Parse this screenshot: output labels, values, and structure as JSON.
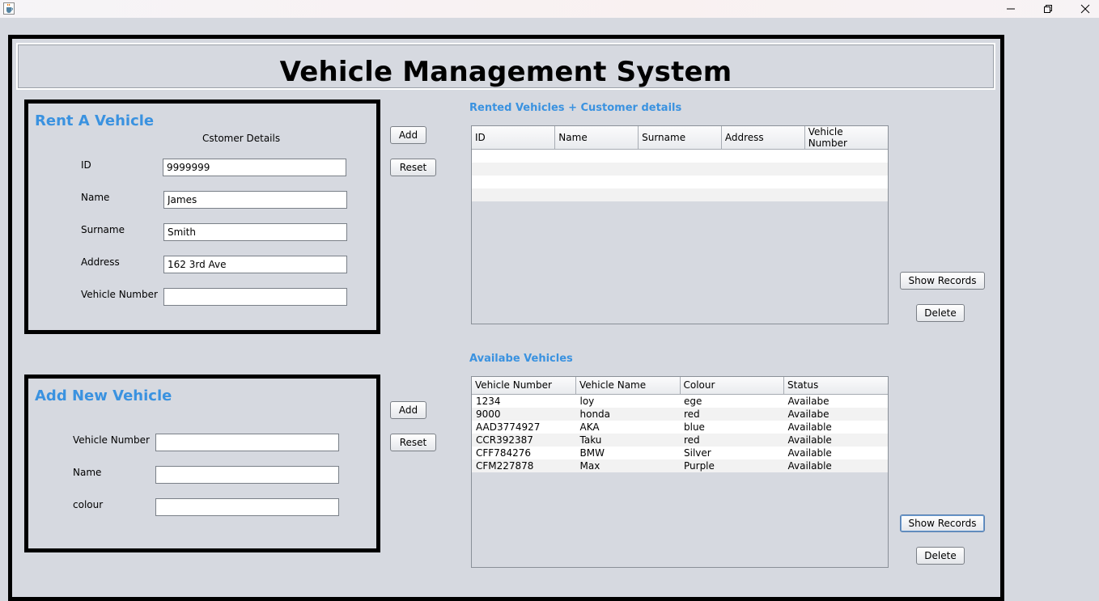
{
  "app": {
    "title": "Vehicle Management System"
  },
  "rent_panel": {
    "title": "Rent A Vehicle",
    "subtitle": "Cstomer Details",
    "fields": [
      {
        "label": "ID",
        "value": "9999999"
      },
      {
        "label": "Name",
        "value": "James"
      },
      {
        "label": "Surname",
        "value": "Smith"
      },
      {
        "label": "Address",
        "value": "162 3rd Ave"
      },
      {
        "label": "Vehicle Number",
        "value": ""
      }
    ],
    "add_label": "Add",
    "reset_label": "Reset"
  },
  "vehicle_panel": {
    "title": "Add New Vehicle",
    "fields": [
      {
        "label": "Vehicle Number",
        "value": ""
      },
      {
        "label": "Name",
        "value": ""
      },
      {
        "label": "colour",
        "value": ""
      }
    ],
    "add_label": "Add",
    "reset_label": "Reset"
  },
  "rented_section": {
    "title": "Rented Vehicles + Customer details",
    "columns": [
      "ID",
      "Name",
      "Surname",
      "Address",
      "Vehicle Number"
    ],
    "rows": [
      [
        "",
        "",
        "",
        "",
        ""
      ],
      [
        "",
        "",
        "",
        "",
        ""
      ],
      [
        "",
        "",
        "",
        "",
        ""
      ],
      [
        "",
        "",
        "",
        "",
        ""
      ]
    ],
    "show_records_label": "Show Records",
    "delete_label": "Delete"
  },
  "available_section": {
    "title": "Availabe Vehicles",
    "columns": [
      "Vehicle Number",
      "Vehicle Name",
      "Colour",
      "Status"
    ],
    "rows": [
      [
        "1234",
        "loy",
        "ege",
        "Availabe"
      ],
      [
        "9000",
        "honda",
        "red",
        "Availabe"
      ],
      [
        "AAD3774927",
        "AKA",
        "blue",
        "Available"
      ],
      [
        "CCR392387",
        "Taku",
        "red",
        "Available"
      ],
      [
        "CFF784276",
        "BMW",
        "Silver",
        "Available"
      ],
      [
        "CFM227878",
        "Max",
        "Purple",
        "Available"
      ]
    ],
    "show_records_label": "Show Records",
    "delete_label": "Delete"
  },
  "colors": {
    "accent": "#3a92e0",
    "background": "#d6d9e0"
  },
  "icons": {
    "app": "java-cup-icon",
    "minimize": "minimize-icon",
    "maximize": "restore-icon",
    "close": "close-icon"
  }
}
